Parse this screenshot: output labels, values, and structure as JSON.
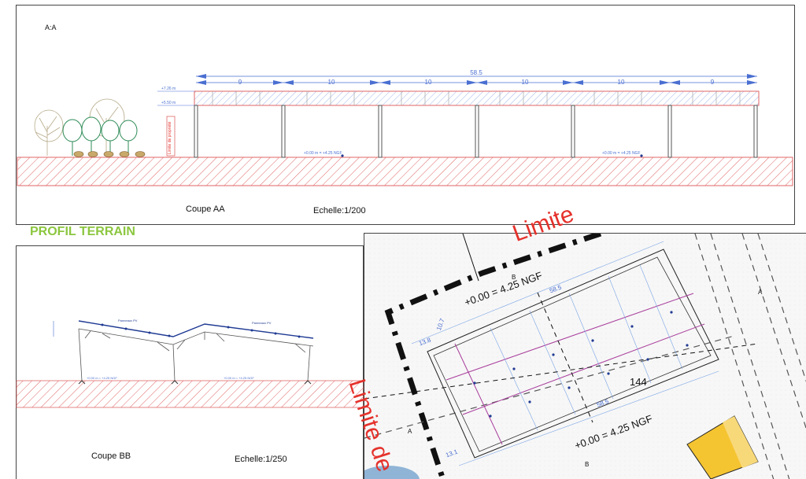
{
  "section_aa": {
    "tag": "A:A",
    "caption": "Coupe AA",
    "scale": "Echelle:1/200",
    "total_length": "58.5",
    "spans": [
      "9",
      "10",
      "10",
      "10",
      "10",
      "9"
    ],
    "level_top": "+7.26 m",
    "level_mid": "+5.50 m",
    "property_limit": "Limite de propriété",
    "ngf_1": "+0.00 m = +4.25 NGF",
    "ngf_2": "+0.00 m = +4.25 NGF"
  },
  "profil_title": "PROFIL TERRAIN",
  "section_bb": {
    "caption": "Coupe BB",
    "scale": "Echelle:1/250",
    "panel_left": "Panneaux PV",
    "panel_right": "Panneaux PV",
    "ngf_1": "+0.00 m = +4.25 NGF",
    "ngf_2": "+0.00 m = +4.25 NGF"
  },
  "plan": {
    "limit_top": "Limite",
    "limit_left": "Limite de",
    "ngf_top": "+0.00 = 4.25 NGF",
    "ngf_bottom": "+0.00 = 4.25 NGF",
    "length": "58.5",
    "length_bottom": "58.5",
    "width": "13.8",
    "width_bottom": "13.1",
    "offset": "10.7",
    "parcel": "144",
    "marker_a": "A",
    "marker_b": "B"
  },
  "colors": {
    "hatch": "#e06666",
    "panel_blue": "#4a6fd1",
    "green_title": "#8cc63f",
    "limit_red": "#e5312b",
    "building": "#f5c431"
  }
}
